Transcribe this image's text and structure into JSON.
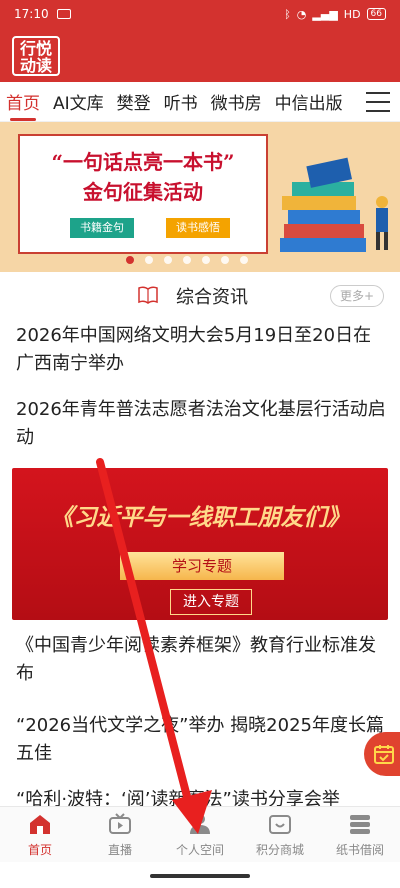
{
  "status_bar": {
    "time": "17:10",
    "network": "HD",
    "battery": "66"
  },
  "logo": {
    "line1": "行悦",
    "line2": "动读"
  },
  "nav": {
    "items": [
      "首页",
      "AI文库",
      "樊登",
      "听书",
      "微书房",
      "中信出版"
    ],
    "active": 0
  },
  "banner": {
    "title_line1": "“一句话点亮一本书”",
    "title_line2": "金句征集活动",
    "tag1": "书籍金句",
    "tag2": "读书感悟",
    "dot_count": 7,
    "active_dot": 0
  },
  "section": {
    "title": "综合资讯",
    "more": "更多+"
  },
  "news": [
    "2026年中国网络文明大会5月19日至20日在广西南宁举办",
    "2026年青年普法志愿者法治文化基层行活动启动",
    "《中国青少年阅读素养框架》教育行业标准发布",
    "“2026当代文学之夜”举办 揭晓2025年度长篇五佳",
    "“哈利·波特：‘阅’读新魔法”读书分享会举"
  ],
  "promo": {
    "title": "《习近平与一线职工朋友们》",
    "subtitle": "学习专题",
    "button": "进入专题"
  },
  "tabbar": {
    "items": [
      "首页",
      "直播",
      "个人空间",
      "积分商城",
      "纸书借阅"
    ],
    "active": 0
  },
  "colors": {
    "brand": "#d3322f",
    "annotation_arrow": "#e8201f"
  }
}
